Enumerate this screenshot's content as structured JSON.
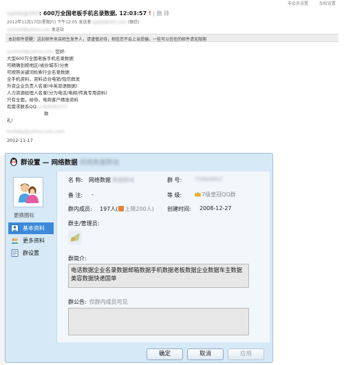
{
  "email": {
    "topbar": [
      "非会员设置",
      "加权设置"
    ],
    "subject_sender": "sgdsb@163",
    "subject_text": ": 600万全国老板手机名录数据, 12:03:57",
    "subject_mark": "!",
    "subject_tail": "| 删 除",
    "meta_line": "2012年11月17日(星期六) 下午12:05  发送者 ",
    "meta_blur": "sgdsb@163.com",
    "meta_tail": " (微信)",
    "meta2_blur": "yunmall@yahoo.com",
    "meta2_text": "  发送站 ",
    "notice": "本封邮件提醒：这封邮件来自陌生发件人，请谨慎对待，相信您不会上当受骗，一些可以信任的邮件请无限期",
    "greeting_blur": "yunmall@yahoo.com",
    "greeting": "  您好:",
    "lines": [
      "大型600万全国老板手机名录数据",
      "可精确到按地区(省份城市)分类",
      "可按照关键词检索行业名录数据",
      "全手机资料，资料适合电销/短信群发",
      "外资企业负责人名录(中英双语数据)",
      "人力资源经理人名录(分为电话/电邮/传真专用资料)",
      "只有全面，给你，电商客户精准资料",
      "有需求联系QQ: ",
      "致",
      "礼!"
    ],
    "qq_blur": "1458283377",
    "signature_blur": "kxdnkly@yahoo.com.com",
    "date": "2012-11-17"
  },
  "dialog": {
    "title": "群设置 — 网络数据",
    "title_blur": "网络数据群组",
    "avatar_caption": "更换图标",
    "nav": [
      {
        "label": "基本资料",
        "active": true,
        "icon": "profile-icon"
      },
      {
        "label": "更多资料",
        "active": false,
        "icon": "more-info-icon"
      },
      {
        "label": "群设置",
        "active": false,
        "icon": "group-settings-icon"
      }
    ],
    "fields": {
      "name_label": "名 称:",
      "name_value": "网络数据",
      "name_blur": "数据群组",
      "number_label": "群    号:",
      "number_blur": "75868802",
      "remark_label": "备 注:",
      "remark_value": "-",
      "level_label": "等    级:",
      "level_value": "7级皇冠QQ群",
      "members_label": "群内成员:",
      "members_value": "197人(",
      "members_cap": "上限200人)",
      "created_label": "创建时间:",
      "created_value": "2008-12-27",
      "admins_label": "群主/管理员:",
      "intro_label": "群简介:",
      "intro_text": "电话数据企业名录数据邮箱数据手机数据老板数据企业数据车主数据美容数据快递国单",
      "notice_label": "群公告:",
      "notice_value": "仅群内成员可见"
    },
    "buttons": {
      "ok": "确定",
      "cancel": "取消",
      "apply": "应用"
    }
  }
}
